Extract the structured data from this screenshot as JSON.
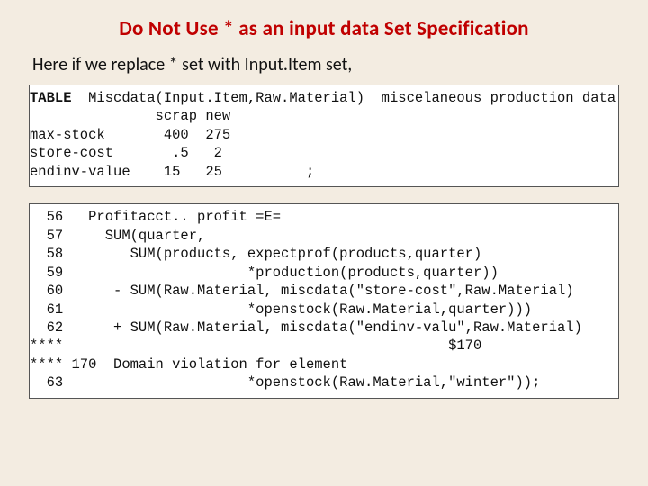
{
  "title": "Do Not Use * as an input data Set Specification",
  "intro": "Here if we replace * set with Input.Item set,",
  "table_block": "TABLE  Miscdata(Input.Item,Raw.Material)  miscelaneous production data\n               scrap new\nmax-stock       400  275\nstore-cost       .5   2\nendinv-value    15   25          ;",
  "table_bold_prefix": "TABLE",
  "code_block": "  56   Profitacct.. profit =E=\n  57     SUM(quarter,\n  58        SUM(products, expectprof(products,quarter)\n  59                      *production(products,quarter))\n  60      - SUM(Raw.Material, miscdata(\"store-cost\",Raw.Material)\n  61                      *openstock(Raw.Material,quarter)))\n  62      + SUM(Raw.Material, miscdata(\"endinv-valu\",Raw.Material)\n****                                              $170\n**** 170  Domain violation for element\n  63                      *openstock(Raw.Material,\"winter\"));"
}
